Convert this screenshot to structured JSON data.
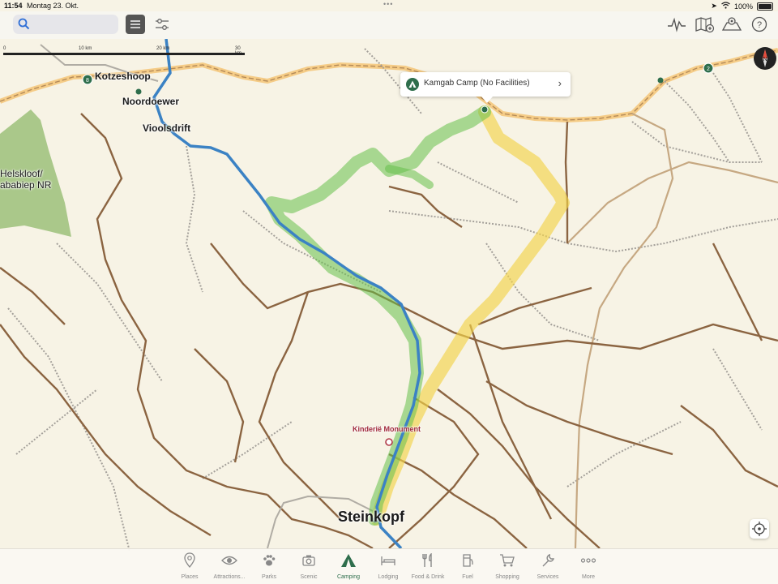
{
  "status": {
    "time": "11:54",
    "date": "Montag 23. Okt.",
    "battery": "100%"
  },
  "search": {
    "placeholder": "",
    "value": ""
  },
  "scale": {
    "km0": "0",
    "km10": "10 km",
    "km20": "20 km",
    "km30": "30 km"
  },
  "map": {
    "places": {
      "kotzeshoop": "Kotzeshoop",
      "noordoewer": "Noordoewer",
      "vioolsdrift": "Vioolsdrift",
      "park_line1": "Helskloof/",
      "park_line2": "ababiep NR",
      "monument": "Kinderië Monument",
      "steinkopf": "Steinkopf"
    },
    "route_badges": {
      "left": "8",
      "right": "2"
    },
    "callout": {
      "title": "Kamgab Camp (No Facilities)"
    },
    "colors": {
      "route_blue": "#3b82c4",
      "route_green": "#66c04a",
      "route_yellow": "#f2d24a",
      "road": "#8b6441",
      "border": "#f5c477",
      "park": "#9cbf7a",
      "accent": "#2e6e4c"
    }
  },
  "toolbar_icons": [
    "elevation-icon",
    "map-add-icon",
    "map-layers-icon",
    "help-icon"
  ],
  "tabs": [
    {
      "label": "Places",
      "icon": "pin-icon"
    },
    {
      "label": "Attractions...",
      "icon": "eye-icon"
    },
    {
      "label": "Parks",
      "icon": "paw-icon"
    },
    {
      "label": "Scenic",
      "icon": "camera-icon"
    },
    {
      "label": "Camping",
      "icon": "tent-icon",
      "active": true
    },
    {
      "label": "Lodging",
      "icon": "bed-icon"
    },
    {
      "label": "Food & Drink",
      "icon": "cutlery-icon"
    },
    {
      "label": "Fuel",
      "icon": "fuel-icon"
    },
    {
      "label": "Shopping",
      "icon": "cart-icon"
    },
    {
      "label": "Services",
      "icon": "wrench-icon"
    },
    {
      "label": "More",
      "icon": "more-icon"
    }
  ]
}
